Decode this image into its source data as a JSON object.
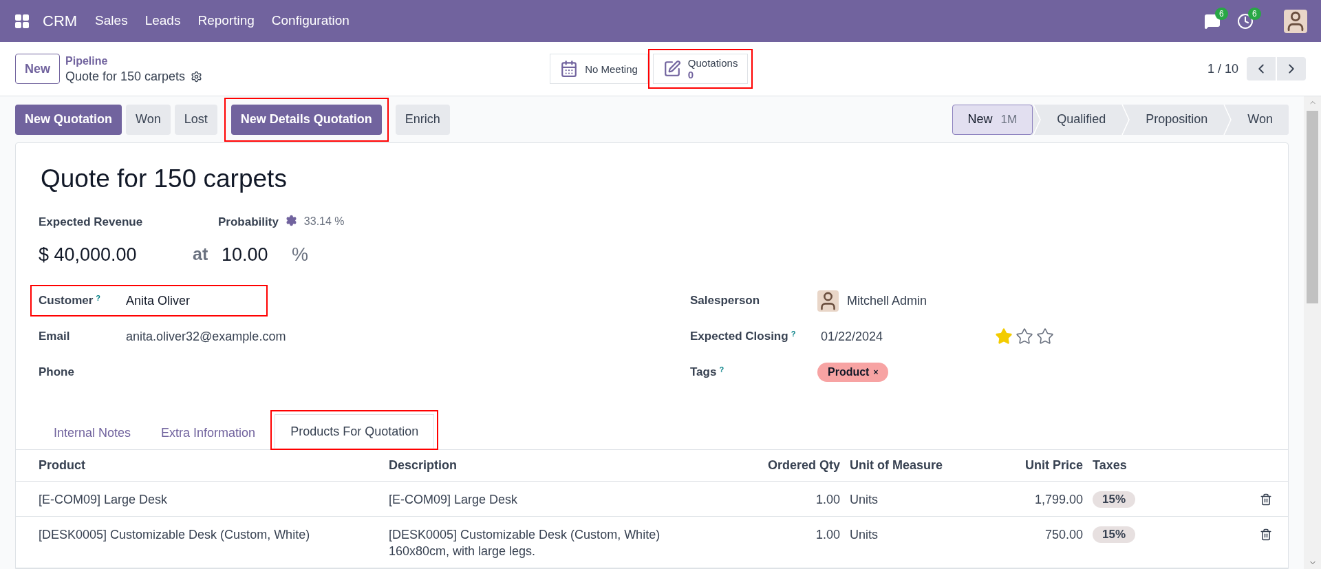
{
  "navbar": {
    "app": "CRM",
    "menu": [
      "Sales",
      "Leads",
      "Reporting",
      "Configuration"
    ],
    "messages_count": "6",
    "activities_count": "6"
  },
  "control_panel": {
    "new_button": "New",
    "breadcrumb": "Pipeline",
    "record_title": "Quote for 150 carpets",
    "smart_buttons": [
      {
        "kind": "meeting",
        "label": "No Meeting",
        "highlighted": false
      },
      {
        "kind": "quotations",
        "label": "Quotations",
        "value": "0",
        "highlighted": true
      }
    ],
    "pager": "1 / 10"
  },
  "actions": [
    {
      "label": "New Quotation",
      "primary": true,
      "highlighted": false
    },
    {
      "label": "Won",
      "primary": false,
      "highlighted": false
    },
    {
      "label": "Lost",
      "primary": false,
      "highlighted": false
    },
    {
      "label": "New Details Quotation",
      "primary": true,
      "highlighted": true
    },
    {
      "label": "Enrich",
      "primary": false,
      "highlighted": false
    }
  ],
  "stages": [
    {
      "label": "New",
      "count": "1M",
      "selected": true
    },
    {
      "label": "Qualified",
      "selected": false
    },
    {
      "label": "Proposition",
      "selected": false
    },
    {
      "label": "Won",
      "selected": false
    }
  ],
  "form": {
    "title": "Quote for 150 carpets",
    "revenue_label": "Expected Revenue",
    "probability_label": "Probability",
    "computed_probability": "33.14 %",
    "revenue": "$ 40,000.00",
    "at": "at",
    "probability": "10.00",
    "percent": "%",
    "customer": {
      "label": "Customer",
      "help": "?",
      "value": "Anita Oliver",
      "highlighted": true
    },
    "email": {
      "label": "Email",
      "value": "anita.oliver32@example.com"
    },
    "phone": {
      "label": "Phone"
    },
    "salesperson": {
      "label": "Salesperson",
      "value": "Mitchell Admin"
    },
    "expected_closing": {
      "label": "Expected Closing",
      "help": "?",
      "value": "01/22/2024",
      "stars": 1
    },
    "tags": {
      "label": "Tags",
      "help": "?",
      "items": [
        {
          "label": "Product",
          "remove": "×",
          "color": "#f7a3a3"
        }
      ]
    }
  },
  "tabs": [
    {
      "label": "Internal Notes",
      "selected": false,
      "highlighted": false
    },
    {
      "label": "Extra Information",
      "selected": false,
      "highlighted": false
    },
    {
      "label": "Products For Quotation",
      "selected": true,
      "highlighted": true
    }
  ],
  "table": {
    "columns": [
      "Product",
      "Description",
      "Ordered Qty",
      "Unit of Measure",
      "Unit Price",
      "Taxes"
    ],
    "rows": [
      {
        "product": "[E-COM09] Large Desk",
        "description": [
          "[E-COM09] Large Desk"
        ],
        "qty": "1.00",
        "uom": "Units",
        "price": "1,799.00",
        "tax": "15%"
      },
      {
        "product": "[DESK0005] Customizable Desk (Custom, White)",
        "description": [
          "[DESK0005] Customizable Desk (Custom, White)",
          "160x80cm, with large legs."
        ],
        "qty": "1.00",
        "uom": "Units",
        "price": "750.00",
        "tax": "15%"
      }
    ]
  }
}
